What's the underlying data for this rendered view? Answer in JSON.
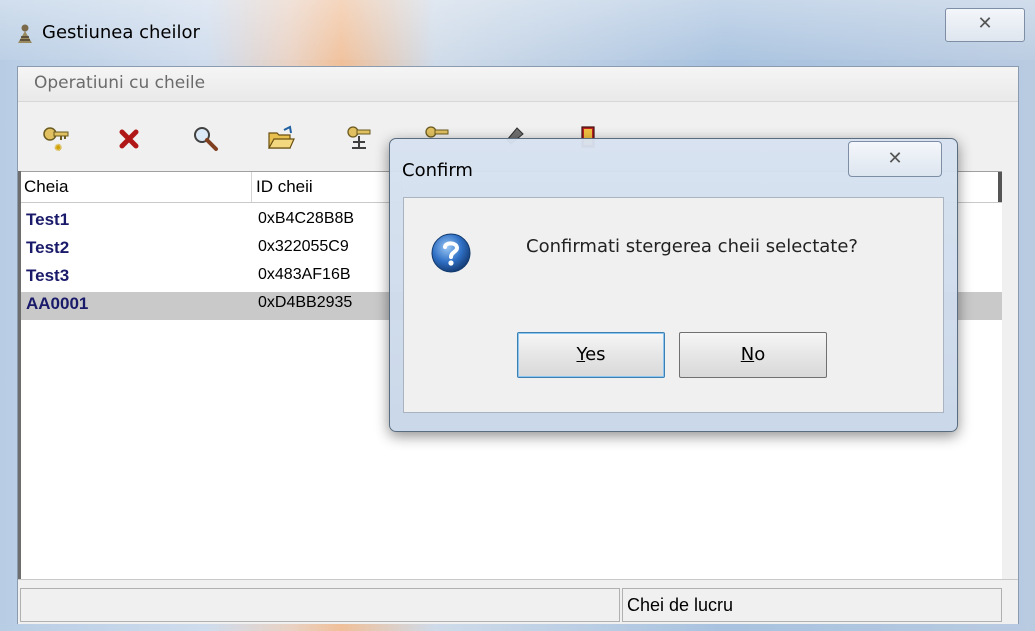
{
  "window": {
    "title": "Gestiunea cheilor",
    "close_glyph": "✕"
  },
  "menu": {
    "items": [
      {
        "label": "Operatiuni cu cheile"
      }
    ]
  },
  "toolbar": {
    "buttons": [
      {
        "icon": "key-add-icon"
      },
      {
        "icon": "delete-icon"
      },
      {
        "icon": "search-icon"
      },
      {
        "icon": "open-folder-icon"
      },
      {
        "icon": "key-network-icon"
      },
      {
        "icon": "key-folder-icon"
      },
      {
        "icon": "brush-icon"
      },
      {
        "icon": "exit-door-icon"
      }
    ]
  },
  "list": {
    "columns": [
      "Cheia",
      "ID cheii"
    ],
    "rows": [
      {
        "name": "Test1",
        "id": "0xB4C28B8B"
      },
      {
        "name": "Test2",
        "id": "0x322055C9"
      },
      {
        "name": "Test3",
        "id": "0x483AF16B"
      },
      {
        "name": "AA0001",
        "id": "0xD4BB2935"
      }
    ],
    "selected_index": 3
  },
  "status": {
    "right_text": "Chei de lucru"
  },
  "dialog": {
    "title": "Confirm",
    "message": "Confirmati stergerea cheii selectate?",
    "close_glyph": "✕",
    "yes_label": "Yes",
    "no_label": "No"
  },
  "colors": {
    "accent": "#1a1a6a",
    "selection": "#c9c9c9",
    "question_icon": "#2f6fc4"
  }
}
